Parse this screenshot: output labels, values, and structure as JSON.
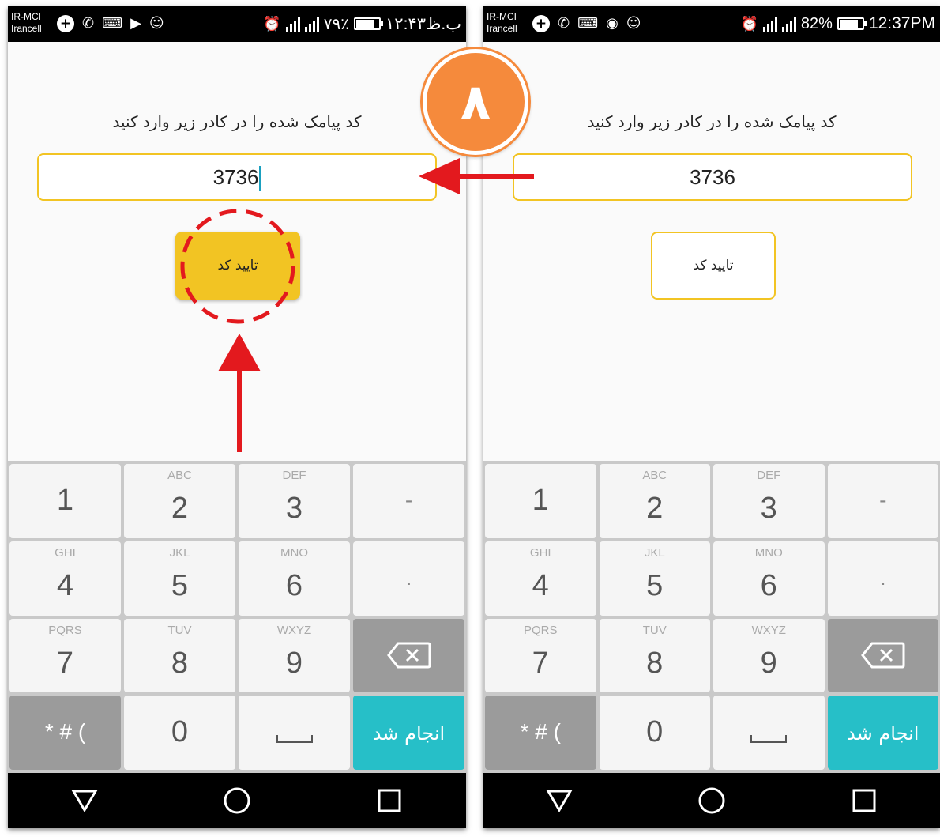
{
  "phones": {
    "left": {
      "status": {
        "carrier_top": "IR-MCI",
        "carrier_bottom": "Irancell",
        "battery_text": "٧٩٪",
        "battery_level": 0.79,
        "clock": "۱۲:۴۳ب.ظ"
      },
      "prompt": "کد پیامک شده را در کادر زیر وارد کنید",
      "code_value": "3736",
      "confirm_label": "تایید کد"
    },
    "right": {
      "status": {
        "carrier_top": "IR-MCI",
        "carrier_bottom": "Irancell",
        "battery_text": "82%",
        "battery_level": 0.82,
        "clock": "12:37PM"
      },
      "prompt": "کد پیامک شده را در کادر زیر وارد کنید",
      "code_value": "3736",
      "confirm_label": "تایید کد"
    }
  },
  "keypad": {
    "rows": [
      [
        {
          "digit": "1",
          "letters": ""
        },
        {
          "digit": "2",
          "letters": "ABC"
        },
        {
          "digit": "3",
          "letters": "DEF"
        },
        {
          "digit": "-",
          "letters": ""
        }
      ],
      [
        {
          "digit": "4",
          "letters": "GHI"
        },
        {
          "digit": "5",
          "letters": "JKL"
        },
        {
          "digit": "6",
          "letters": "MNO"
        },
        {
          "digit": ".",
          "letters": ""
        }
      ],
      [
        {
          "digit": "7",
          "letters": "PQRS"
        },
        {
          "digit": "8",
          "letters": "TUV"
        },
        {
          "digit": "9",
          "letters": "WXYZ"
        }
      ],
      [
        {
          "digit": "* # (",
          "letters": ""
        },
        {
          "digit": "0",
          "letters": ""
        }
      ]
    ],
    "done_label": "انجام شد"
  },
  "status_icons": [
    "plus-icon",
    "phone-icon",
    "keyboard-icon",
    "play-store-icon",
    "sms-icon",
    "alarm-icon",
    "signal-icon"
  ],
  "step_badge": "۸",
  "colors": {
    "accent_yellow": "#f2c423",
    "done_teal": "#26bfc8",
    "annotation_red": "#e3191e",
    "badge_orange": "#f58a3c"
  }
}
